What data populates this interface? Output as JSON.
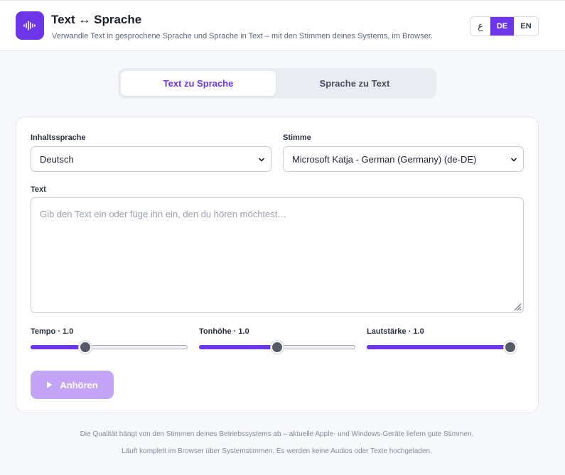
{
  "header": {
    "title": "Text ↔ Sprache",
    "subtitle": "Verwandle Text in gesprochene Sprache und Sprache in Text – mit den Stimmen deines Systems, im Browser.",
    "logo_icon": "waveform-icon",
    "lang_options": {
      "icon_label": "ع",
      "de": "DE",
      "en": "EN"
    },
    "active_lang": "DE"
  },
  "tabs": [
    {
      "label": "Text zu Sprache",
      "active": true
    },
    {
      "label": "Sprache zu Text",
      "active": false
    }
  ],
  "form": {
    "content_language": {
      "label": "Inhaltssprache",
      "value": "Deutsch"
    },
    "voice": {
      "label": "Stimme",
      "value": "Microsoft Katja - German (Germany) (de-DE)"
    },
    "text": {
      "label": "Text",
      "placeholder": "Gib den Text ein oder füge ihn ein, den du hören möchtest…",
      "value": ""
    },
    "sliders": [
      {
        "label": "Tempo",
        "value_text": "· 1.0",
        "fraction": 0.35
      },
      {
        "label": "Tonhöhe",
        "value_text": "· 1.0",
        "fraction": 0.5
      },
      {
        "label": "Lautstärke",
        "value_text": "· 1.0",
        "fraction": 1.0
      }
    ],
    "listen_button": "Anhören"
  },
  "footer": {
    "line1": "Die Qualität hängt von den Stimmen deines Betriebssystems ab – aktuelle Apple- und Windows-Geräte liefern gute Stimmen.",
    "line2": "Läuft komplett im Browser über Systemstimmen. Es werden keine Audios oder Texte hochgeladen."
  },
  "colors": {
    "accent": "#6d35e8",
    "button_disabled": "#c4a4f4",
    "page_bg": "#f7f8fb"
  }
}
